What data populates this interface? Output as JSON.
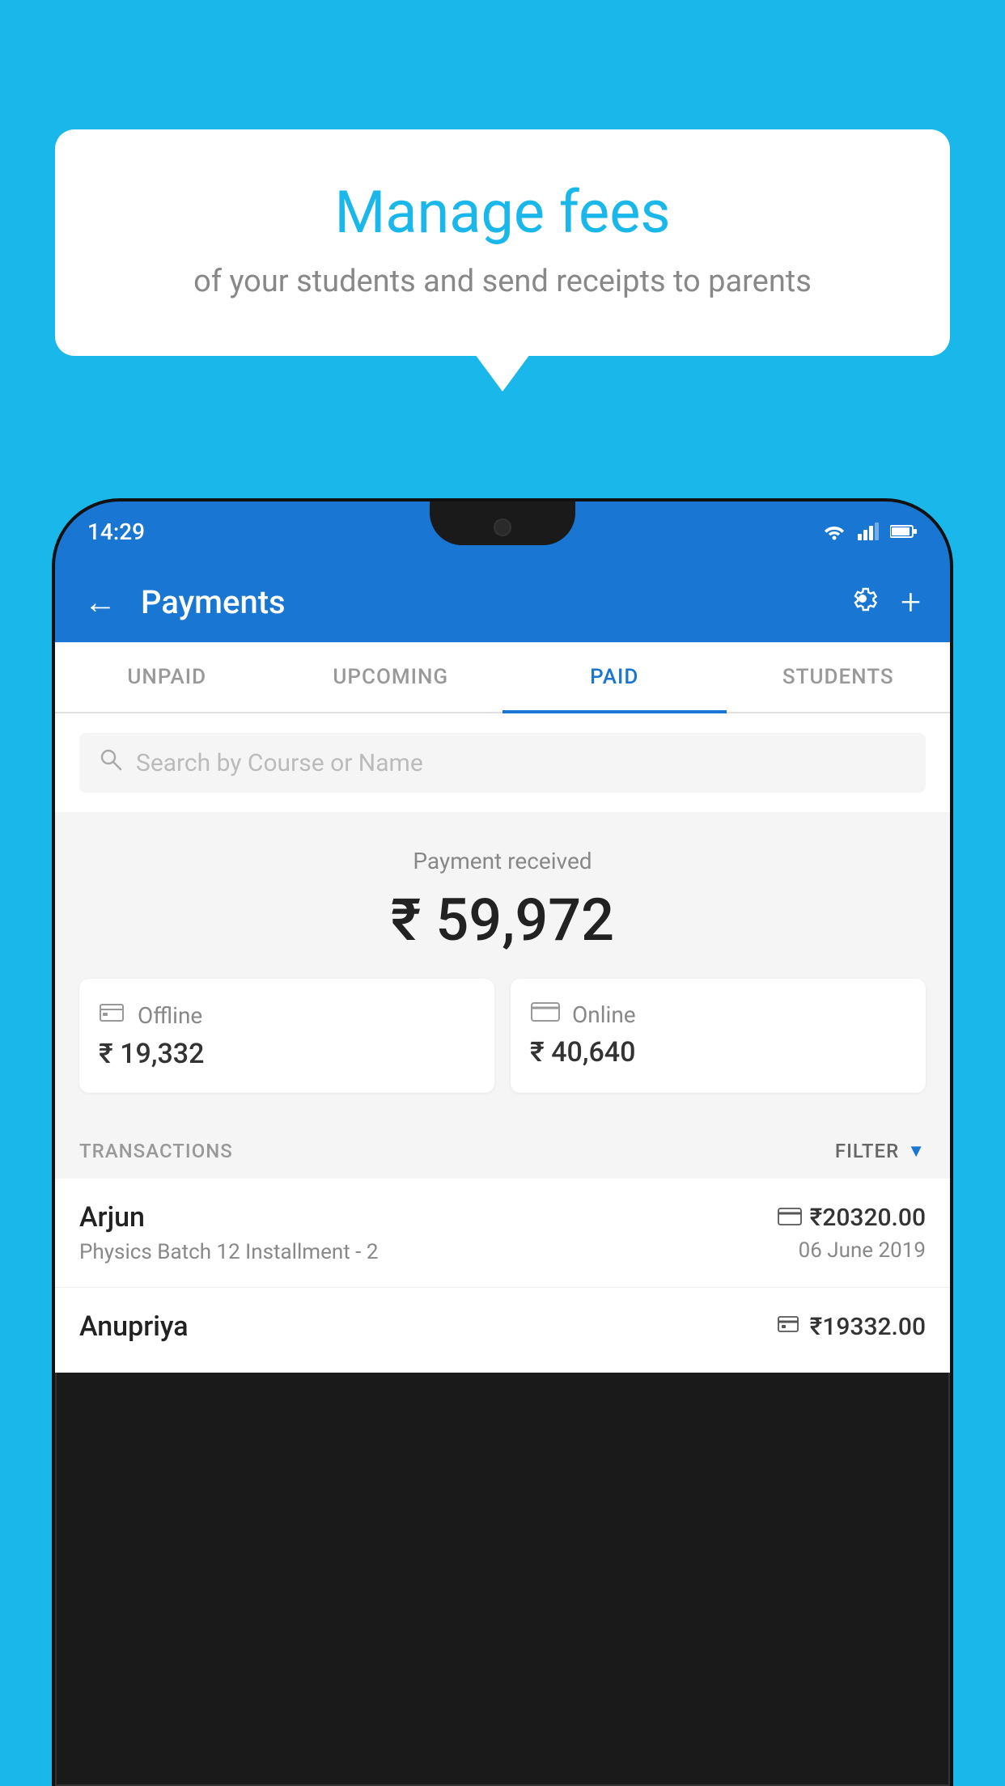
{
  "background_color": "#1ab7ea",
  "bubble": {
    "title": "Manage fees",
    "subtitle": "of your students and send receipts to parents"
  },
  "phone": {
    "status_bar": {
      "time": "14:29"
    },
    "header": {
      "title": "Payments",
      "back_label": "←",
      "gear_icon": "gear",
      "plus_icon": "+"
    },
    "tabs": [
      {
        "label": "UNPAID",
        "active": false
      },
      {
        "label": "UPCOMING",
        "active": false
      },
      {
        "label": "PAID",
        "active": true
      },
      {
        "label": "STUDENTS",
        "active": false
      }
    ],
    "search": {
      "placeholder": "Search by Course or Name"
    },
    "payment_summary": {
      "label": "Payment received",
      "amount": "₹ 59,972",
      "offline": {
        "label": "Offline",
        "amount": "₹ 19,332"
      },
      "online": {
        "label": "Online",
        "amount": "₹ 40,640"
      }
    },
    "transactions_section": {
      "label": "TRANSACTIONS",
      "filter_label": "FILTER"
    },
    "transactions": [
      {
        "name": "Arjun",
        "detail": "Physics Batch 12 Installment - 2",
        "amount": "₹20320.00",
        "date": "06 June 2019",
        "payment_type": "online"
      },
      {
        "name": "Anupriya",
        "detail": "",
        "amount": "₹19332.00",
        "date": "",
        "payment_type": "offline"
      }
    ]
  }
}
